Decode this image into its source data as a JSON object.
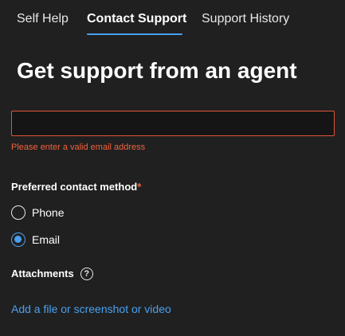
{
  "tabs": [
    {
      "label": "Self Help",
      "active": false
    },
    {
      "label": "Contact Support",
      "active": true
    },
    {
      "label": "Support History",
      "active": false
    }
  ],
  "heading": "Get support from an agent",
  "email": {
    "value": "",
    "placeholder": "",
    "error": "Please enter a valid email address"
  },
  "contact_method": {
    "label": "Preferred contact method",
    "required_marker": "*",
    "options": [
      {
        "label": "Phone",
        "checked": false
      },
      {
        "label": "Email",
        "checked": true
      }
    ]
  },
  "attachments": {
    "label": "Attachments",
    "help_icon": "?",
    "add_link": "Add a file or screenshot or video"
  },
  "colors": {
    "background": "#202020",
    "accent": "#4aa0f0",
    "error": "#f0623e"
  }
}
